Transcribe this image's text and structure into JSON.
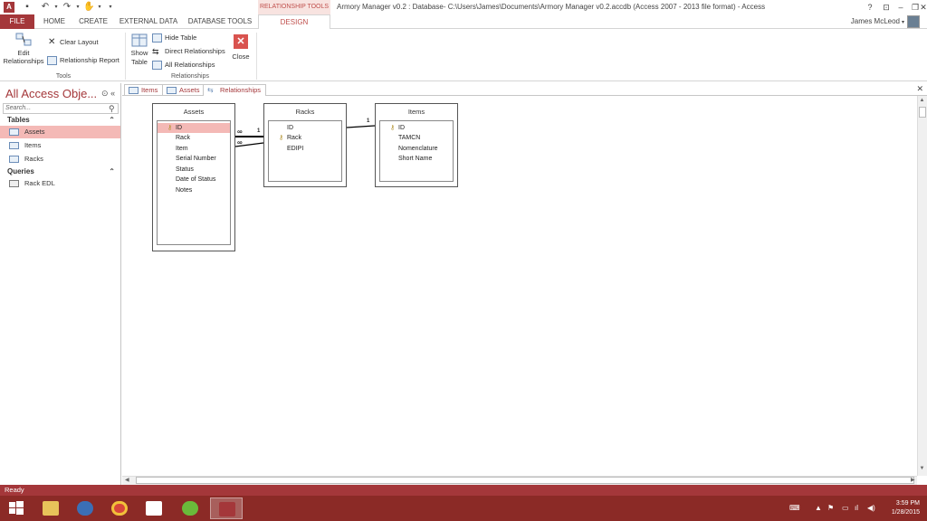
{
  "titlebar": {
    "context_tab_label": "RELATIONSHIP TOOLS",
    "window_title": "Armory Manager v0.2 : Database- C:\\Users\\James\\Documents\\Armory Manager v0.2.accdb (Access 2007 - 2013 file format) - Access",
    "help": "?",
    "minimize": "–",
    "restore": "❐",
    "close": "✕"
  },
  "tabs": {
    "file": "FILE",
    "home": "HOME",
    "create": "CREATE",
    "external_data": "EXTERNAL DATA",
    "database_tools": "DATABASE TOOLS",
    "design": "DESIGN"
  },
  "user": {
    "name": "James McLeod"
  },
  "ribbon": {
    "tools": {
      "label": "Tools",
      "edit_relationships": "Edit Relationships",
      "clear_layout": "Clear Layout",
      "relationship_report": "Relationship Report"
    },
    "relationships": {
      "label": "Relationships",
      "show_table_1": "Show",
      "show_table_2": "Table",
      "hide_table": "Hide Table",
      "direct_relationships": "Direct Relationships",
      "all_relationships": "All Relationships",
      "close": "Close"
    }
  },
  "nav": {
    "title": "All Access Obje...",
    "search_placeholder": "Search...",
    "tables_header": "Tables",
    "tables": [
      {
        "label": "Assets"
      },
      {
        "label": "Items"
      },
      {
        "label": "Racks"
      }
    ],
    "queries_header": "Queries",
    "queries": [
      {
        "label": "Rack EDL"
      }
    ]
  },
  "doc_tabs": [
    {
      "label": "Items"
    },
    {
      "label": "Assets"
    },
    {
      "label": "Relationships"
    }
  ],
  "diagram": {
    "assets": {
      "title": "Assets",
      "fields": [
        "ID",
        "Rack",
        "Item",
        "Serial Number",
        "Status",
        "Date of Status",
        "Notes"
      ]
    },
    "racks": {
      "title": "Racks",
      "fields": [
        "ID",
        "Rack",
        "EDIPI"
      ]
    },
    "items": {
      "title": "Items",
      "fields": [
        "ID",
        "TAMCN",
        "Nomenclature",
        "Short Name"
      ]
    },
    "rel_one_1": "1",
    "rel_many_1": "∞",
    "rel_many_2": "∞",
    "rel_one_2": "1"
  },
  "status": {
    "text": "Ready"
  },
  "taskbar": {
    "time": "3:59 PM",
    "date": "1/28/2015"
  },
  "colors": {
    "accent": "#a4373a",
    "selected_row": "#f4b9b6",
    "taskbar": "#8b2a26"
  }
}
